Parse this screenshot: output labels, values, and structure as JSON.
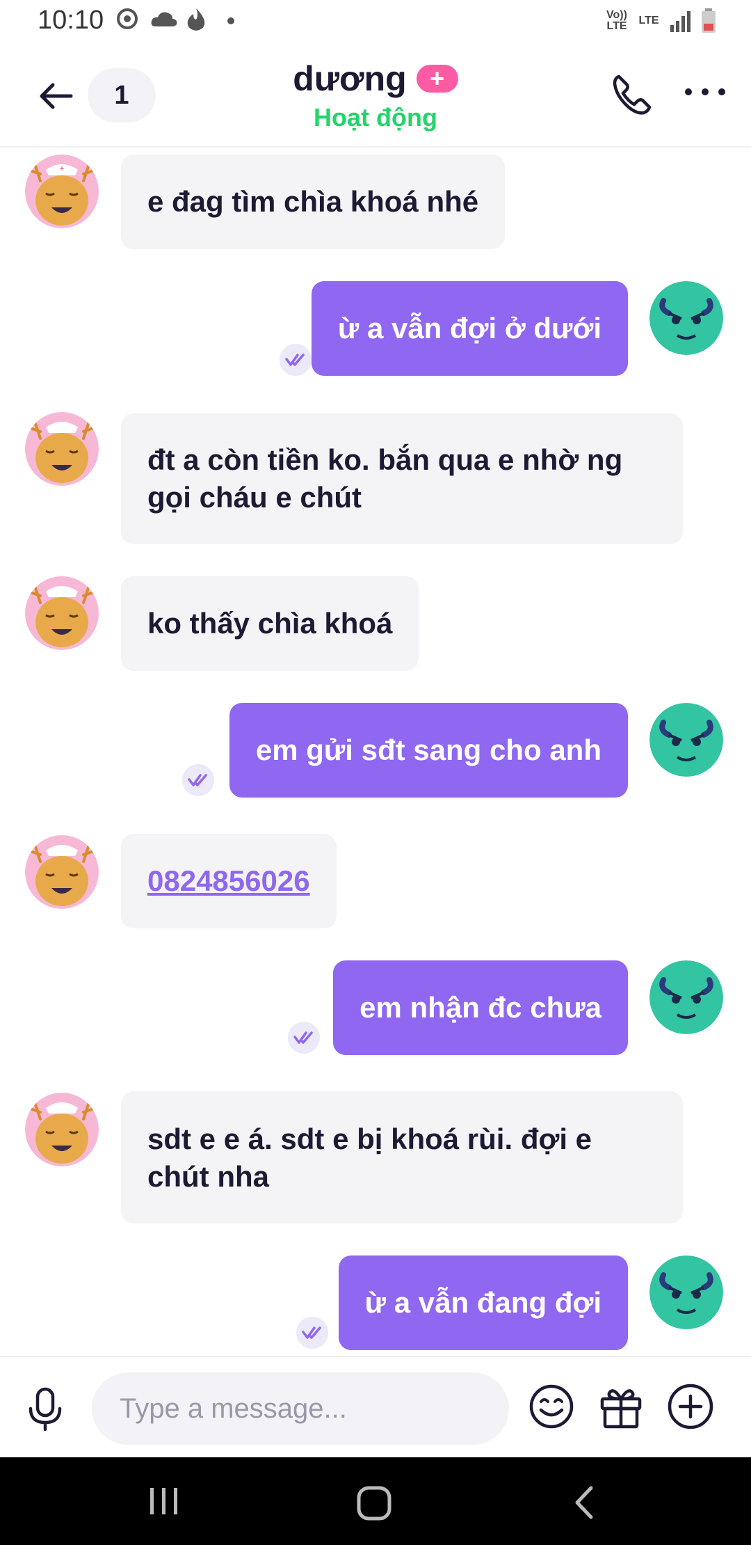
{
  "status_bar": {
    "time": "10:10",
    "net1": "Vo)) LTE",
    "net2": "LTE",
    "icons": [
      "camera-sync-icon",
      "cloud-icon",
      "flame-icon",
      "dot-icon",
      "signal-icon",
      "battery-icon"
    ]
  },
  "header": {
    "unread_count": "1",
    "contact_name": "dương",
    "plus_badge": "+",
    "presence": "Hoạt động",
    "presence_color": "#22d46a"
  },
  "colors": {
    "outgoing_bubble": "#8f67f0",
    "incoming_bubble": "#f4f4f7",
    "badge": "#ff5aa4"
  },
  "messages": [
    {
      "dir": "in",
      "text": "e đag tìm chìa khoá nhé"
    },
    {
      "dir": "out",
      "text": "ừ a vẫn đợi ở dưới",
      "read": true
    },
    {
      "dir": "in",
      "text": "đt a còn tiền ko. bắn qua e nhờ ng gọi cháu e chút"
    },
    {
      "dir": "in",
      "text": "ko thấy chìa khoá"
    },
    {
      "dir": "out",
      "text": "em gửi sđt sang cho anh",
      "read": true
    },
    {
      "dir": "in",
      "text": "0824856026",
      "is_link": true
    },
    {
      "dir": "out",
      "text": "em nhận đc chưa",
      "read": true
    },
    {
      "dir": "in",
      "text": "sdt e e á. sdt e bị khoá rùi. đợi e chút nha"
    },
    {
      "dir": "out",
      "text": "ừ a vẫn đang đợi",
      "read": true
    }
  ],
  "input": {
    "placeholder": "Type a message...",
    "value": ""
  },
  "icons": {
    "back": "back-arrow-icon",
    "call": "phone-icon",
    "more": "more-icon",
    "mic": "microphone-icon",
    "emoji": "emoji-icon",
    "gift": "gift-icon",
    "add": "add-icon"
  }
}
